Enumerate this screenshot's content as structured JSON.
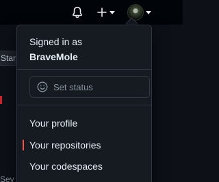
{
  "header": {
    "notifications_icon": "bell-icon",
    "create_icon": "plus-icon",
    "avatar_icon": "user-avatar"
  },
  "background": {
    "star_fragment": "Star",
    "bottom_fragment": "Sev"
  },
  "menu": {
    "signed_in_label": "Signed in as",
    "username": "BraveMole",
    "set_status_placeholder": "Set status",
    "status_icon": "smiley-icon",
    "items": [
      {
        "label": "Your profile",
        "active": false
      },
      {
        "label": "Your repositories",
        "active": true
      },
      {
        "label": "Your codespaces",
        "active": false
      }
    ]
  },
  "colors": {
    "background": "#0d1117",
    "menu_background": "#161b22",
    "border": "#30363d",
    "text": "#e6edf3",
    "muted": "#8b949e",
    "accent_active": "#f85149"
  }
}
